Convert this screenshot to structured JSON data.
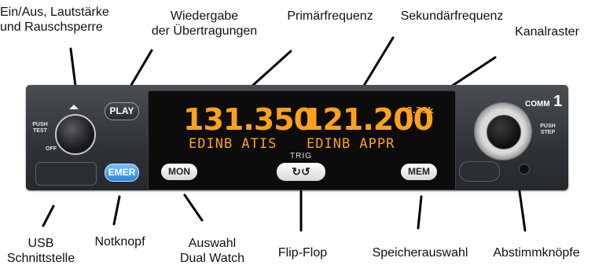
{
  "labels": {
    "power": [
      "Ein/Aus, Lautstärke",
      "und Rauschsperre"
    ],
    "playback": [
      "Wiedergabe",
      "der Übertragungen"
    ],
    "primary": "Primärfrequenz",
    "secondary": "Sekundärfrequenz",
    "spacing": "Kanalraster",
    "usb": [
      "USB",
      "Schnittstelle"
    ],
    "emergency": "Notknopf",
    "dualwatch": [
      "Auswahl",
      "Dual Watch"
    ],
    "flipflop": "Flip-Flop",
    "memory": "Speicherauswahl",
    "tuning": "Abstimmknöpfe"
  },
  "device": {
    "brand": "COMM",
    "brand_number": "1",
    "power_knob_top": [
      "PUSH",
      "TEST"
    ],
    "power_knob_bottom": "OFF",
    "tune_knob_label": [
      "PUSH",
      "STEP"
    ],
    "buttons": {
      "play": "PLAY",
      "emer": "EMER",
      "mon": "MON",
      "trig": "TRIG",
      "mem": "MEM"
    },
    "display": {
      "primary_freq": "131.350",
      "secondary_freq": "121.200",
      "channel_spacing": "8.33k",
      "primary_name": "EDINB ATIS",
      "secondary_name": "EDINB APPR"
    },
    "colors": {
      "display_text": "#ffa21a",
      "emer_button": "#2b86d8",
      "panel": "#2f3236"
    }
  }
}
